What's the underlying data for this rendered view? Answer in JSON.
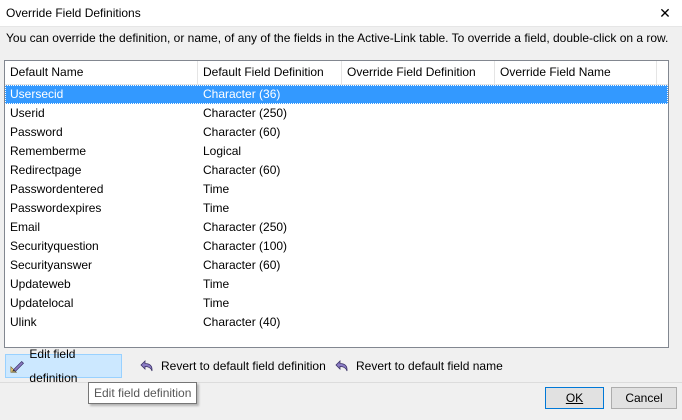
{
  "window": {
    "title": "Override Field Definitions",
    "description": "You can override the definition, or name, of any of the fields in the Active-Link table. To override a field, double-click on a row."
  },
  "table": {
    "columns": [
      "Default Name",
      "Default Field Definition",
      "Override Field Definition",
      "Override Field Name"
    ],
    "rows": [
      {
        "name": "Usersecid",
        "definition": "Character (36)",
        "override_def": "",
        "override_name": "",
        "selected": true
      },
      {
        "name": "Userid",
        "definition": "Character (250)",
        "override_def": "",
        "override_name": ""
      },
      {
        "name": "Password",
        "definition": "Character (60)",
        "override_def": "",
        "override_name": ""
      },
      {
        "name": "Rememberme",
        "definition": "Logical",
        "override_def": "",
        "override_name": ""
      },
      {
        "name": "Redirectpage",
        "definition": "Character (60)",
        "override_def": "",
        "override_name": ""
      },
      {
        "name": "Passwordentered",
        "definition": "Time",
        "override_def": "",
        "override_name": ""
      },
      {
        "name": "Passwordexpires",
        "definition": "Time",
        "override_def": "",
        "override_name": ""
      },
      {
        "name": "Email",
        "definition": "Character (250)",
        "override_def": "",
        "override_name": ""
      },
      {
        "name": "Securityquestion",
        "definition": "Character (100)",
        "override_def": "",
        "override_name": ""
      },
      {
        "name": "Securityanswer",
        "definition": "Character (60)",
        "override_def": "",
        "override_name": ""
      },
      {
        "name": "Updateweb",
        "definition": "Time",
        "override_def": "",
        "override_name": ""
      },
      {
        "name": "Updatelocal",
        "definition": "Time",
        "override_def": "",
        "override_name": ""
      },
      {
        "name": "Ulink",
        "definition": "Character (40)",
        "override_def": "",
        "override_name": ""
      }
    ]
  },
  "toolbar": {
    "edit_label": "Edit field definition",
    "edit_icon": "pencil-ruler-icon",
    "revert_def_label": "Revert to default field definition",
    "revert_def_icon": "undo-arrow-icon",
    "revert_name_label": "Revert to default field name",
    "revert_name_icon": "undo-arrow-icon"
  },
  "tooltip": {
    "text": "Edit field definition"
  },
  "buttons": {
    "ok": "OK",
    "cancel": "Cancel"
  },
  "colors": {
    "selection": "#3399ff",
    "hover_button": "#cce8ff",
    "icon_purple": "#6b5fb0"
  }
}
